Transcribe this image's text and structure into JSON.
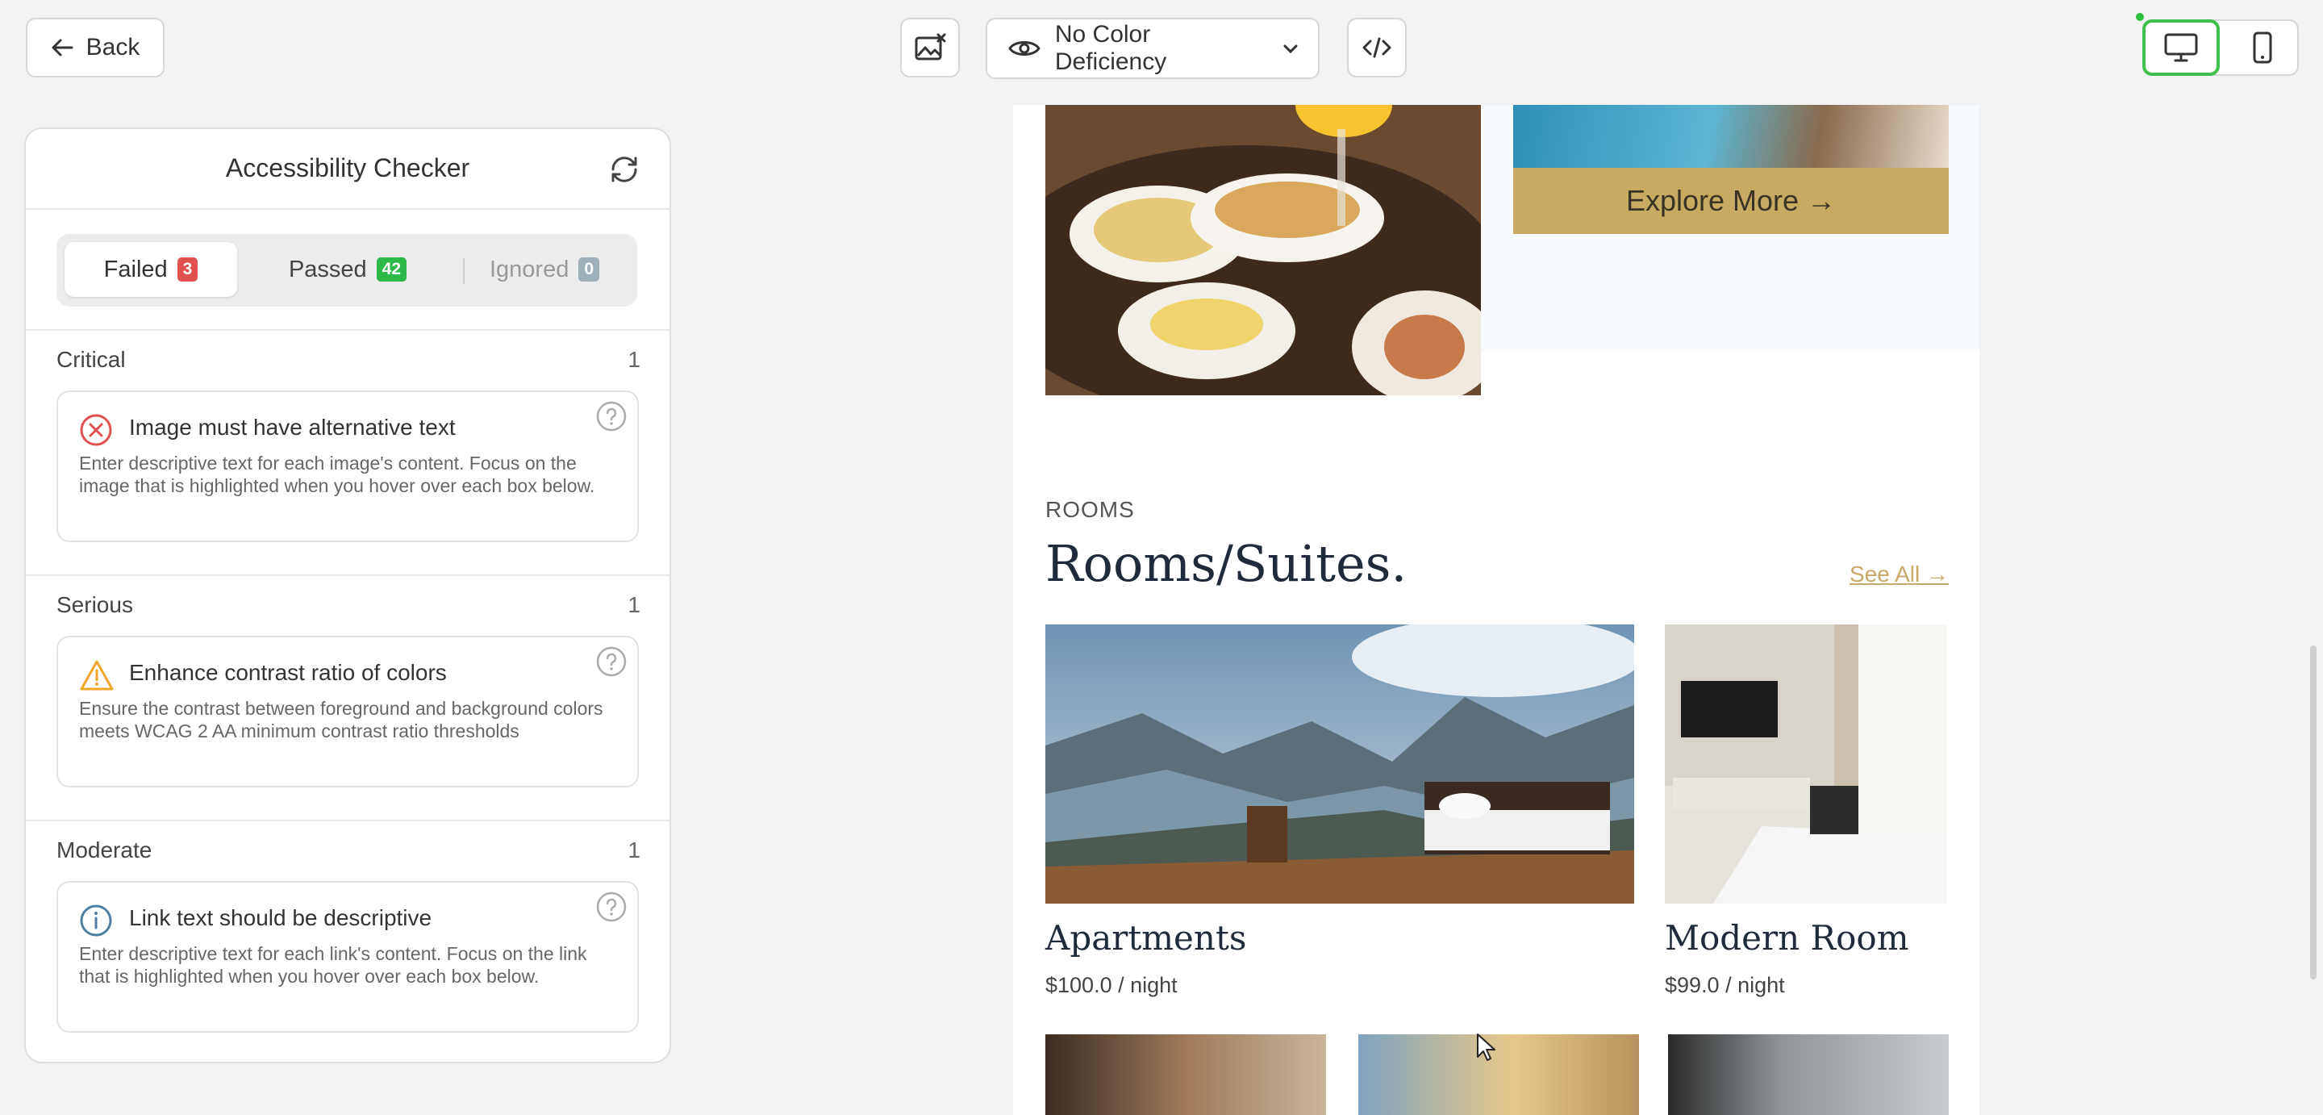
{
  "toolbar": {
    "back_label": "Back",
    "color_deficiency": "No Color Deficiency"
  },
  "panel": {
    "title": "Accessibility Checker",
    "tabs": [
      {
        "label": "Failed",
        "count": "3",
        "color": "#e0524f"
      },
      {
        "label": "Passed",
        "count": "42",
        "color": "#2db84a"
      },
      {
        "label": "Ignored",
        "count": "0",
        "color": "#9fb0bb"
      }
    ],
    "sections": [
      {
        "name": "Critical",
        "count": "1",
        "issue_title": "Image must have alternative text",
        "issue_desc": "Enter descriptive text for each image's content. Focus on the image that is highlighted when you hover over each box below.",
        "icon": "error-circle-icon"
      },
      {
        "name": "Serious",
        "count": "1",
        "issue_title": "Enhance contrast ratio of colors",
        "issue_desc": "Ensure the contrast between foreground and background colors meets WCAG 2 AA minimum contrast ratio thresholds",
        "icon": "warning-triangle-icon"
      },
      {
        "name": "Moderate",
        "count": "1",
        "issue_title": "Link text should be descriptive",
        "issue_desc": "Enter descriptive text for each link's content. Focus on the link that is highlighted when you hover over each box below.",
        "icon": "info-circle-icon"
      }
    ]
  },
  "preview": {
    "explore_label": "Explore More →",
    "rooms_eyebrow": "ROOMS",
    "rooms_title": "Rooms/Suites.",
    "see_all": "See All →",
    "rooms": [
      {
        "name": "Apartments",
        "price": "$100.0 / night"
      },
      {
        "name": "Modern Room",
        "price": "$99.0 / night"
      }
    ]
  },
  "colors": {
    "accent_green": "#3ec04a",
    "gold": "#c8aa63",
    "error": "#e0524f",
    "warning": "#f0a52a",
    "info": "#4e7fa3"
  }
}
